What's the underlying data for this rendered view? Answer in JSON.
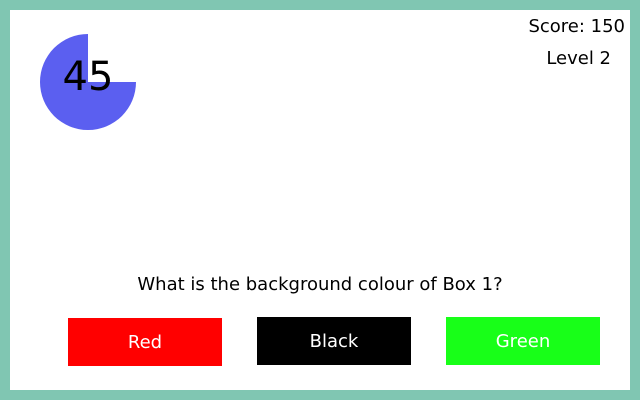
{
  "timer": {
    "value": "45",
    "fraction_remaining": 0.75,
    "color": "#5b5ff0"
  },
  "status": {
    "score": "Score: 150",
    "level": "Level 2"
  },
  "question": {
    "text": "What is the background colour of Box 1?"
  },
  "answers": [
    {
      "label": "Red",
      "bg": "#ff0000",
      "fg": "#ffffff"
    },
    {
      "label": "Black",
      "bg": "#000000",
      "fg": "#ffffff"
    },
    {
      "label": "Green",
      "bg": "#18ff18",
      "fg": "#ffffff"
    }
  ],
  "colors": {
    "background": "#80c6b2",
    "panel": "#ffffff"
  }
}
